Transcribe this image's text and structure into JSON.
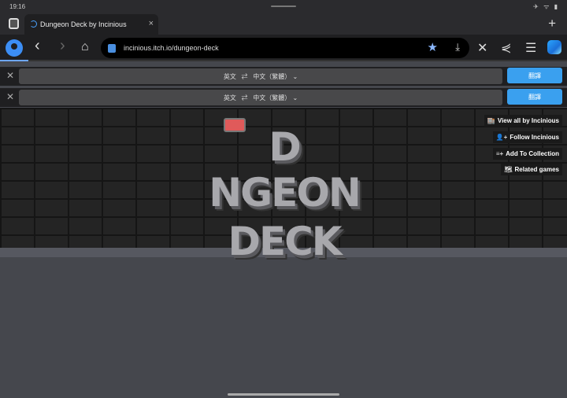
{
  "status": {
    "time": "19:16",
    "icons": "✈ ᯤ ▮"
  },
  "tab": {
    "title": "Dungeon Deck by Incinious",
    "close": "×",
    "new": "+"
  },
  "nav": {
    "back": "‹",
    "forward": "›",
    "home": "⌂",
    "url": "incinious.itch.io/dungeon-deck",
    "star": "★",
    "download": "⤓",
    "close": "✕",
    "share": "⋞",
    "menu": "☰"
  },
  "translate_bars": [
    {
      "close": "✕",
      "source": "英文",
      "swap": "⇄",
      "target": "中文（繁體）",
      "chevron": "⌄",
      "button": "翻譯"
    },
    {
      "close": "✕",
      "source": "英文",
      "swap": "⇄",
      "target": "中文（繁體）",
      "chevron": "⌄",
      "button": "翻譯"
    }
  ],
  "logo": {
    "line1": "D NGEON",
    "line2": "DECK"
  },
  "side_buttons": [
    {
      "icon": "🏬",
      "label": "View all by Incinious"
    },
    {
      "icon": "👤+",
      "label": "Follow Incinious"
    },
    {
      "icon": "≡+",
      "label": "Add To Collection"
    },
    {
      "icon": "🗺",
      "label": "Related games"
    }
  ]
}
